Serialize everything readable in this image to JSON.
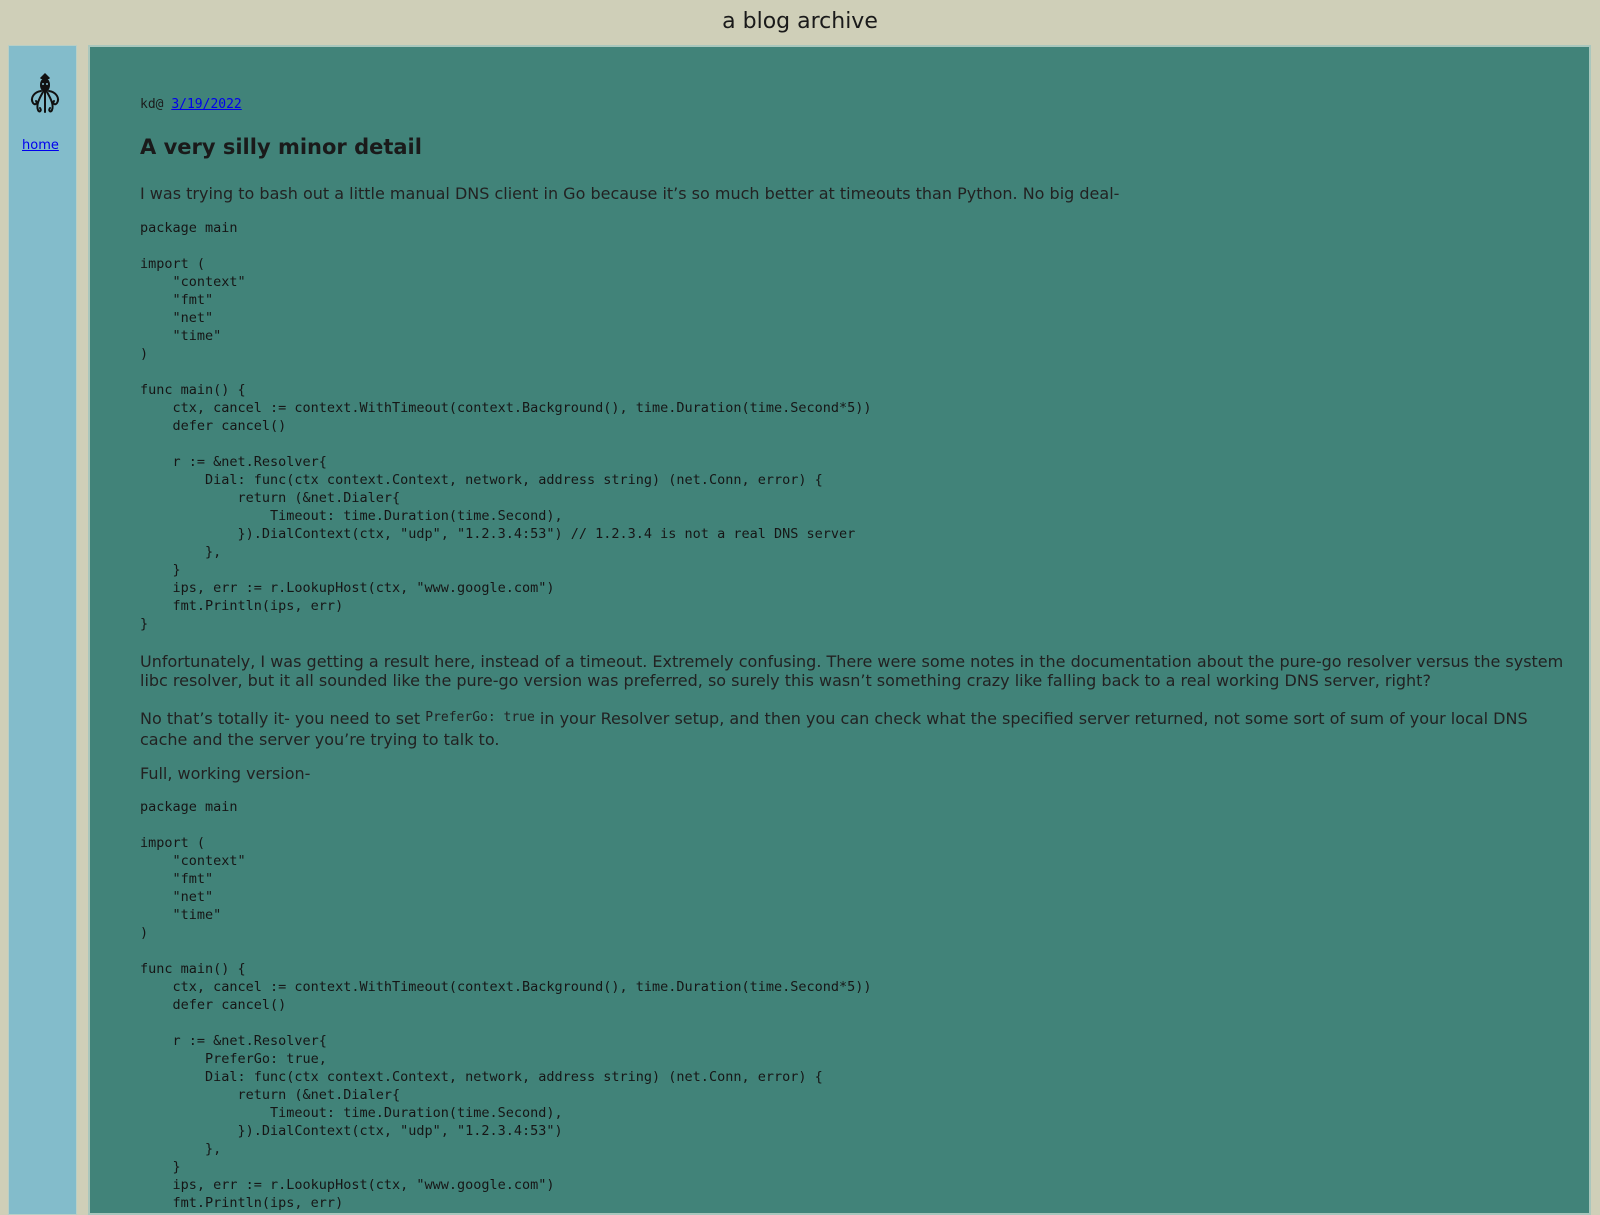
{
  "site": {
    "title": "a blog archive"
  },
  "sidebar": {
    "logo_icon": "squid-icon",
    "home_label": "home"
  },
  "post": {
    "author": "kd@",
    "date": "3/19/2022",
    "title": "A very silly minor detail",
    "intro": "I was trying to bash out a little manual DNS client in Go because it’s so much better at timeouts than Python. No big deal-",
    "code1": "package main\n\nimport (\n    \"context\"\n    \"fmt\"\n    \"net\"\n    \"time\"\n)\n\nfunc main() {\n    ctx, cancel := context.WithTimeout(context.Background(), time.Duration(time.Second*5))\n    defer cancel()\n\n    r := &net.Resolver{\n        Dial: func(ctx context.Context, network, address string) (net.Conn, error) {\n            return (&net.Dialer{\n                Timeout: time.Duration(time.Second),\n            }).DialContext(ctx, \"udp\", \"1.2.3.4:53\") // 1.2.3.4 is not a real DNS server\n        },\n    }\n    ips, err := r.LookupHost(ctx, \"www.google.com\")\n    fmt.Println(ips, err)\n}",
    "para2": "Unfortunately, I was getting a result here, instead of a timeout. Extremely confusing. There were some notes in the documentation about the pure-go resolver versus the system libc resolver, but it all sounded like the pure-go version was preferred, so surely this wasn’t something crazy like falling back to a real working DNS server, right?",
    "para3_before": "No that’s totally it- you need to set ",
    "para3_code": "PreferGo: true",
    "para3_after": " in your Resolver setup, and then you can check what the specified server returned, not some sort of sum of your local DNS cache and the server you’re trying to talk to.",
    "para4": "Full, working version-",
    "code2": "package main\n\nimport (\n    \"context\"\n    \"fmt\"\n    \"net\"\n    \"time\"\n)\n\nfunc main() {\n    ctx, cancel := context.WithTimeout(context.Background(), time.Duration(time.Second*5))\n    defer cancel()\n\n    r := &net.Resolver{\n        PreferGo: true,\n        Dial: func(ctx context.Context, network, address string) (net.Conn, error) {\n            return (&net.Dialer{\n                Timeout: time.Duration(time.Second),\n            }).DialContext(ctx, \"udp\", \"1.2.3.4:53\")\n        },\n    }\n    ips, err := r.LookupHost(ctx, \"www.google.com\")\n    fmt.Println(ips, err)\n}"
  }
}
